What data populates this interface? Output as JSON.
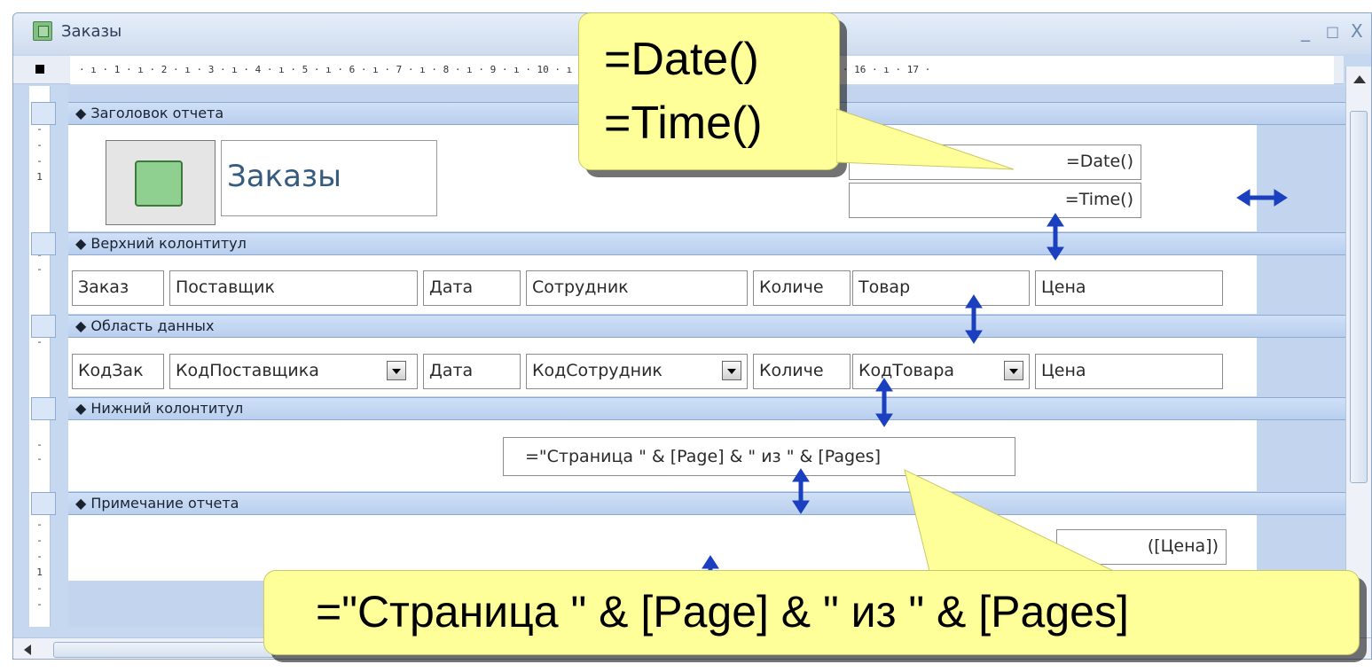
{
  "window": {
    "title": "Заказы",
    "minimize": "_",
    "maximize": "□",
    "close": "X"
  },
  "ruler": {
    "marks": "· ı · 1 · ı · 2 · ı · 3 · ı · 4 · ı · 5 · ı · 6 · ı · 7 · ı · 8 · ı · 9 · ı · 10 · ı · 11 · ı · 12 · ı · 13 · ı · 14 · ı · 15 · ı · 16 · ı · 17 ·"
  },
  "sections": {
    "report_header": "Заголовок отчета",
    "page_header": "Верхний колонтитул",
    "detail": "Область данных",
    "page_footer": "Нижний колонтитул",
    "report_footer": "Примечание отчета"
  },
  "report_header": {
    "title": "Заказы",
    "date_expr": "=Date()",
    "time_expr": "=Time()"
  },
  "page_header": {
    "labels": [
      "Заказ",
      "Поставщик",
      "Дата",
      "Сотрудник",
      "Количе",
      "Товар",
      "Цена"
    ]
  },
  "detail": {
    "fields": [
      "КодЗак",
      "КодПоставщика",
      "Дата",
      "КодСотрудник",
      "Количе",
      "КодТовара",
      "Цена"
    ]
  },
  "page_footer": {
    "expr": "=\"Страница \" & [Page] & \" из \" & [Pages]"
  },
  "report_footer": {
    "expr_partial": "([Цена])"
  },
  "callouts": {
    "top_line1": "=Date()",
    "top_line2": "=Time()",
    "bottom": "=\"Страница \" & [Page] & \" из \" & [Pages]"
  },
  "colors": {
    "arrow": "#1a3fbf",
    "callout_bg": "#ffff99",
    "section_bar": "#c9dcf5"
  }
}
